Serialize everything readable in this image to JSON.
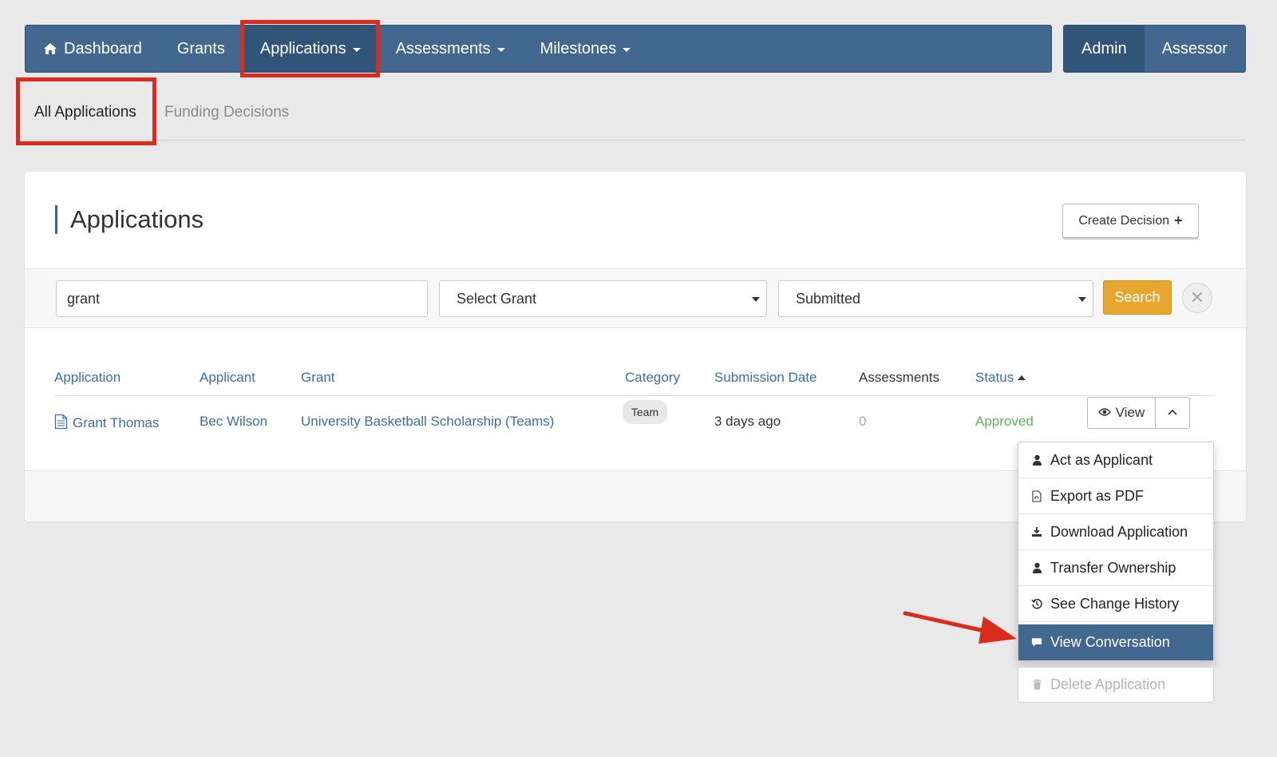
{
  "nav": {
    "items": [
      {
        "label": "Dashboard",
        "icon": "home-icon"
      },
      {
        "label": "Grants"
      },
      {
        "label": "Applications",
        "dropdown": true,
        "active": true
      },
      {
        "label": "Assessments",
        "dropdown": true
      },
      {
        "label": "Milestones",
        "dropdown": true
      }
    ],
    "roles": [
      {
        "label": "Admin",
        "active": true
      },
      {
        "label": "Assessor"
      }
    ]
  },
  "subtabs": [
    {
      "label": "All Applications",
      "active": true
    },
    {
      "label": "Funding Decisions",
      "active": false
    }
  ],
  "card": {
    "title": "Applications",
    "create_button": "Create Decision"
  },
  "filters": {
    "search_value": "grant",
    "grant_select": "Select Grant",
    "status_select": "Submitted",
    "search_button": "Search",
    "clear_icon": "close-icon"
  },
  "table": {
    "headers": [
      "Application",
      "Applicant",
      "Grant",
      "Category",
      "Submission Date",
      "Assessments",
      "Status"
    ],
    "sorted_column": "Status",
    "rows": [
      {
        "application": "Grant Thomas",
        "applicant": "Bec Wilson",
        "grant": "University Basketball Scholarship (Teams)",
        "category": "Team",
        "submission_date": "3 days ago",
        "assessments": "0",
        "status": "Approved",
        "view_label": "View"
      }
    ]
  },
  "actions_menu": {
    "items": [
      {
        "label": "Act as Applicant",
        "icon": "user-icon"
      },
      {
        "label": "Export as PDF",
        "icon": "pdf-file-icon"
      },
      {
        "label": "Download Application",
        "icon": "download-icon"
      },
      {
        "label": "Transfer Ownership",
        "icon": "user-icon"
      },
      {
        "label": "See Change History",
        "icon": "history-icon"
      },
      {
        "label": "View Conversation",
        "icon": "comment-icon",
        "selected": true
      }
    ],
    "delete_label": "Delete Application",
    "delete_icon": "trash-icon"
  },
  "colors": {
    "nav_bg": "#436890",
    "nav_active": "#315479",
    "link": "#3c6ea6",
    "search_button": "#e7a72e",
    "approved": "#5cb85c",
    "highlight": "#d92c1c"
  }
}
